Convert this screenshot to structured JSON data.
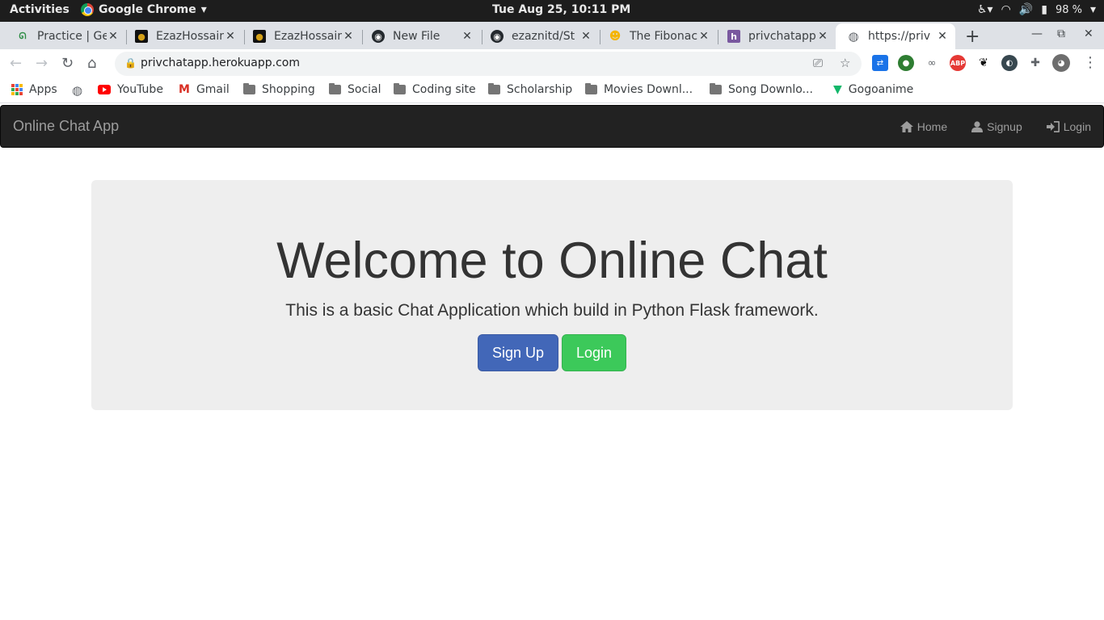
{
  "system_bar": {
    "activities": "Activities",
    "app_name": "Google Chrome",
    "clock": "Tue Aug 25, 10:11 PM",
    "battery": "98 %"
  },
  "tabs": [
    {
      "title": "Practice | Ge",
      "favicon": "gfg-icon",
      "active": false
    },
    {
      "title": "EzazHossain",
      "favicon": "profile-icon",
      "active": false
    },
    {
      "title": "EzazHossain",
      "favicon": "profile-icon",
      "active": false
    },
    {
      "title": "New File",
      "favicon": "github-icon",
      "active": false
    },
    {
      "title": "ezaznitd/St",
      "favicon": "github-icon",
      "active": false
    },
    {
      "title": "The Fibonac",
      "favicon": "emoji-icon",
      "active": false
    },
    {
      "title": "privchatapp",
      "favicon": "heroku-icon",
      "active": false
    },
    {
      "title": "https://priv",
      "favicon": "globe-icon",
      "active": true
    }
  ],
  "omnibox": {
    "url": "privchatapp.herokuapp.com"
  },
  "bookmarks": [
    {
      "label": "Apps",
      "icon": "apps-grid-icon"
    },
    {
      "label": "",
      "icon": "globe-icon"
    },
    {
      "label": "YouTube",
      "icon": "youtube-icon"
    },
    {
      "label": "Gmail",
      "icon": "gmail-icon"
    },
    {
      "label": "Shopping",
      "icon": "folder-icon"
    },
    {
      "label": "Social",
      "icon": "folder-icon"
    },
    {
      "label": "Coding site",
      "icon": "folder-icon"
    },
    {
      "label": "Scholarship",
      "icon": "folder-icon"
    },
    {
      "label": "Movies Downl...",
      "icon": "folder-icon"
    },
    {
      "label": "Song Downlo...",
      "icon": "folder-icon"
    },
    {
      "label": "Gogoanime",
      "icon": "gogoanime-icon"
    }
  ],
  "site": {
    "brand": "Online Chat App",
    "nav": {
      "home": "Home",
      "signup": "Signup",
      "login": "Login"
    },
    "hero": {
      "title": "Welcome to Online Chat",
      "subtitle": "This is a basic Chat Application which build in Python Flask framework.",
      "signup_button": "Sign Up",
      "login_button": "Login"
    },
    "colors": {
      "navbar": "#222222",
      "primary": "#4267b8",
      "success": "#3cc95a",
      "jumbotron": "#eeeeee"
    }
  }
}
